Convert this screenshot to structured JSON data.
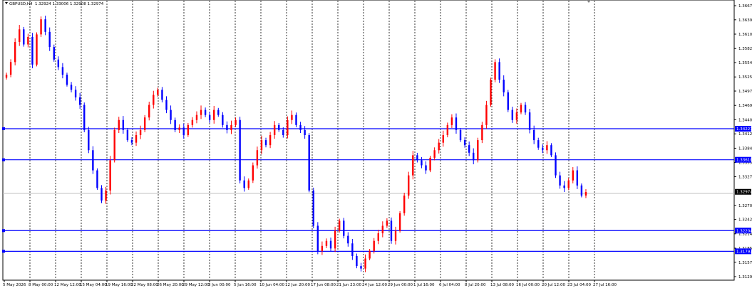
{
  "header": {
    "symbol_label": "GBPUSD,H4",
    "ohlc_text": "1.32924 1.33006 1.32908 1.32974"
  },
  "price_axis": {
    "labels": [
      "1.36670",
      "1.36390",
      "1.36105",
      "1.35820",
      "1.35540",
      "1.35255",
      "1.34975",
      "1.34690",
      "1.34405",
      "1.34125",
      "1.33840",
      "1.33555",
      "1.33275",
      "1.32705",
      "1.32425",
      "1.32140",
      "1.31855",
      "1.31575",
      "1.31290"
    ]
  },
  "time_axis": {
    "labels": [
      "5 May 2026",
      "8 May 00:00",
      "12 May 12:00",
      "15 May 04:00",
      "19 May 16:00",
      "22 May 08:00",
      "26 May 20:00",
      "29 May 12:00",
      "3 Jun 00:00",
      "5 Jun 16:00",
      "10 Jun 04:00",
      "12 Jun 20:00",
      "17 Jun 08:00",
      "21 Jun 23:00",
      "24 Jun 12:00",
      "29 Jun 00:00",
      "1 Jul 16:00",
      "6 Jul 04:00",
      "8 Jul 20:00",
      "13 Jul 08:00",
      "16 Jul 00:00",
      "20 Jul 12:00",
      "23 Jul 04:00",
      "27 Jul 16:00"
    ]
  },
  "horizontal_lines": [
    {
      "name": "hline-1",
      "price": 1.34227,
      "label": "1.34227"
    },
    {
      "name": "hline-2",
      "price": 1.3361,
      "label": "1.33610"
    },
    {
      "name": "hline-3",
      "price": 1.32204,
      "label": "1.32204"
    },
    {
      "name": "hline-4",
      "price": 1.31793,
      "label": "1.31793"
    }
  ],
  "current_price": {
    "price": 1.32974,
    "label": "1.32974"
  },
  "colors": {
    "bull": "#ff0000",
    "bear": "#0000ff",
    "hline": "#0000ff",
    "grid": "#000000",
    "current_line": "#c0c0c0",
    "current_badge": "#000000"
  },
  "chart_data": {
    "type": "line",
    "series": [
      {
        "values": [
          1.353,
          1.3555,
          1.3595,
          1.362,
          1.359,
          1.3605,
          1.355,
          1.361,
          1.364,
          1.3615,
          1.3585,
          1.356,
          1.3545,
          1.353,
          1.351,
          1.35,
          1.3485,
          1.347,
          1.342,
          1.338,
          1.334,
          1.3305,
          1.328,
          1.33,
          1.336,
          1.342,
          1.344,
          1.342,
          1.34,
          1.3395,
          1.341,
          1.342,
          1.3445,
          1.347,
          1.349,
          1.35,
          1.348,
          1.346,
          1.344,
          1.342,
          1.3425,
          1.341,
          1.343,
          1.344,
          1.345,
          1.346,
          1.345,
          1.344,
          1.346,
          1.345,
          1.343,
          1.342,
          1.343,
          1.344,
          1.332,
          1.3305,
          1.332,
          1.335,
          1.338,
          1.34,
          1.339,
          1.341,
          1.343,
          1.342,
          1.341,
          1.344,
          1.345,
          1.343,
          1.342,
          1.341,
          1.33,
          1.323,
          1.318,
          1.319,
          1.32,
          1.3185,
          1.322,
          1.324,
          1.321,
          1.3195,
          1.317,
          1.315,
          1.3145,
          1.3165,
          1.318,
          1.32,
          1.3215,
          1.323,
          1.324,
          1.32,
          1.322,
          1.3255,
          1.329,
          1.333,
          1.337,
          1.336,
          1.335,
          1.334,
          1.3365,
          1.338,
          1.3395,
          1.341,
          1.343,
          1.3445,
          1.342,
          1.34,
          1.339,
          1.3375,
          1.336,
          1.34,
          1.343,
          1.347,
          1.352,
          1.3555,
          1.352,
          1.3495,
          1.346,
          1.344,
          1.3455,
          1.347,
          1.3455,
          1.342,
          1.34,
          1.3385,
          1.338,
          1.339,
          1.337,
          1.333,
          1.331,
          1.3305,
          1.332,
          1.334,
          1.331,
          1.329,
          1.3297
        ]
      }
    ],
    "xlabel": "",
    "ylabel": "",
    "ylim": [
      1.3129,
      1.3667
    ]
  }
}
